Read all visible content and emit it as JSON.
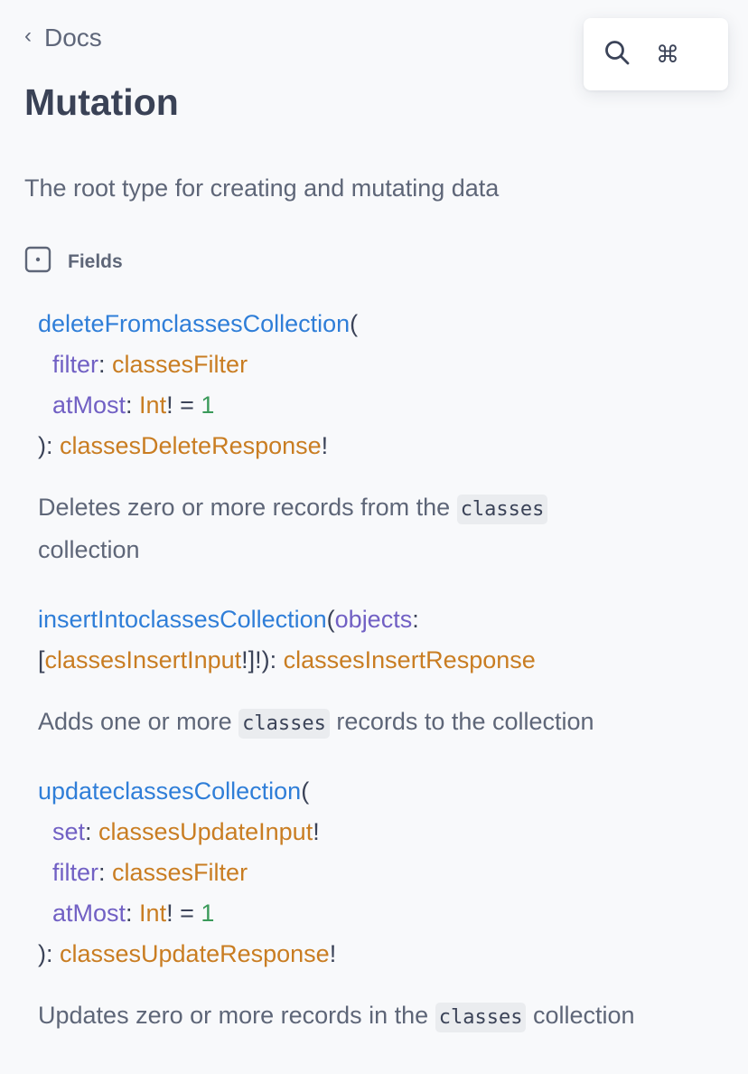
{
  "nav": {
    "back_label": "Docs"
  },
  "title": "Mutation",
  "search": {
    "shortcut": "⌘"
  },
  "description": "The root type for creating and mutating data",
  "section_label": "Fields",
  "fields": [
    {
      "name": "deleteFromclassesCollection",
      "args": [
        {
          "name": "filter",
          "type": "classesFilter"
        },
        {
          "name": "atMost",
          "type": "Int",
          "default": "1"
        }
      ],
      "return_type": "classesDeleteResponse",
      "description": {
        "before": "Deletes zero or more records from the",
        "code": "classes",
        "after": "collection"
      }
    },
    {
      "name": "insertIntoclassesCollection",
      "args": [
        {
          "name": "objects",
          "type": "classesInsertInput"
        }
      ],
      "return_type": "classesInsertResponse",
      "description": {
        "before": "Adds one or more",
        "code": "classes",
        "after": "records to the collection"
      }
    },
    {
      "name": "updateclassesCollection",
      "args": [
        {
          "name": "set",
          "type": "classesUpdateInput"
        },
        {
          "name": "filter",
          "type": "classesFilter"
        },
        {
          "name": "atMost",
          "type": "Int",
          "default": "1"
        }
      ],
      "return_type": "classesUpdateResponse",
      "description": {
        "before": "Updates zero or more records in the",
        "code": "classes",
        "after": "collection"
      }
    }
  ],
  "colors": {
    "field_name": "#2f7ed8",
    "argument": "#7160c4",
    "type": "#c97d22",
    "number": "#3a9a5a",
    "heading": "#3a4256"
  }
}
